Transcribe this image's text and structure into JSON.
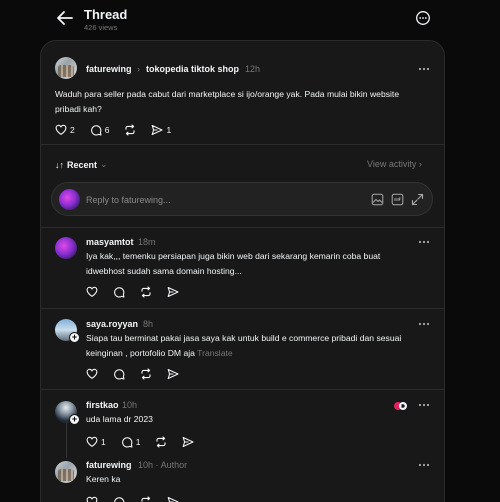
{
  "header": {
    "title": "Thread",
    "views": "426 views"
  },
  "post": {
    "username": "faturewing",
    "community": "tokopedia tiktok shop",
    "time": "12h",
    "text": "Waduh para seller pada cabut dari marketplace si ijo/orange yak. Pada mulai bikin website pribadi kah?",
    "likes": "2",
    "replies": "6",
    "shares": "1"
  },
  "sort": {
    "label": "Recent",
    "view_activity": "View activity"
  },
  "reply_box": {
    "placeholder": "Reply to faturewing..."
  },
  "replies": [
    {
      "username": "masyamtot",
      "time": "18m",
      "text": "Iya kak,,, temenku persiapan juga bikin web dari sekarang kemarin coba buat idwebhost sudah sama domain hosting..."
    },
    {
      "username": "saya.royyan",
      "time": "8h",
      "text": "Siapa tau berminat pakai jasa saya kak untuk build e commerce pribadi dan sesuai keinginan , portofolio DM aja",
      "translate": "Translate"
    },
    {
      "username": "firstkao",
      "time": "10h",
      "text": "uda lama dr 2023",
      "likes": "1",
      "replies": "1"
    },
    {
      "username": "faturewing",
      "time": "10h",
      "author_label": "Author",
      "text": "Keren ka"
    }
  ],
  "colors": {
    "background": "#0a0a0a",
    "card": "#181818",
    "text": "#f3f5f7",
    "muted": "#777777",
    "divider": "#2c2c2c"
  }
}
